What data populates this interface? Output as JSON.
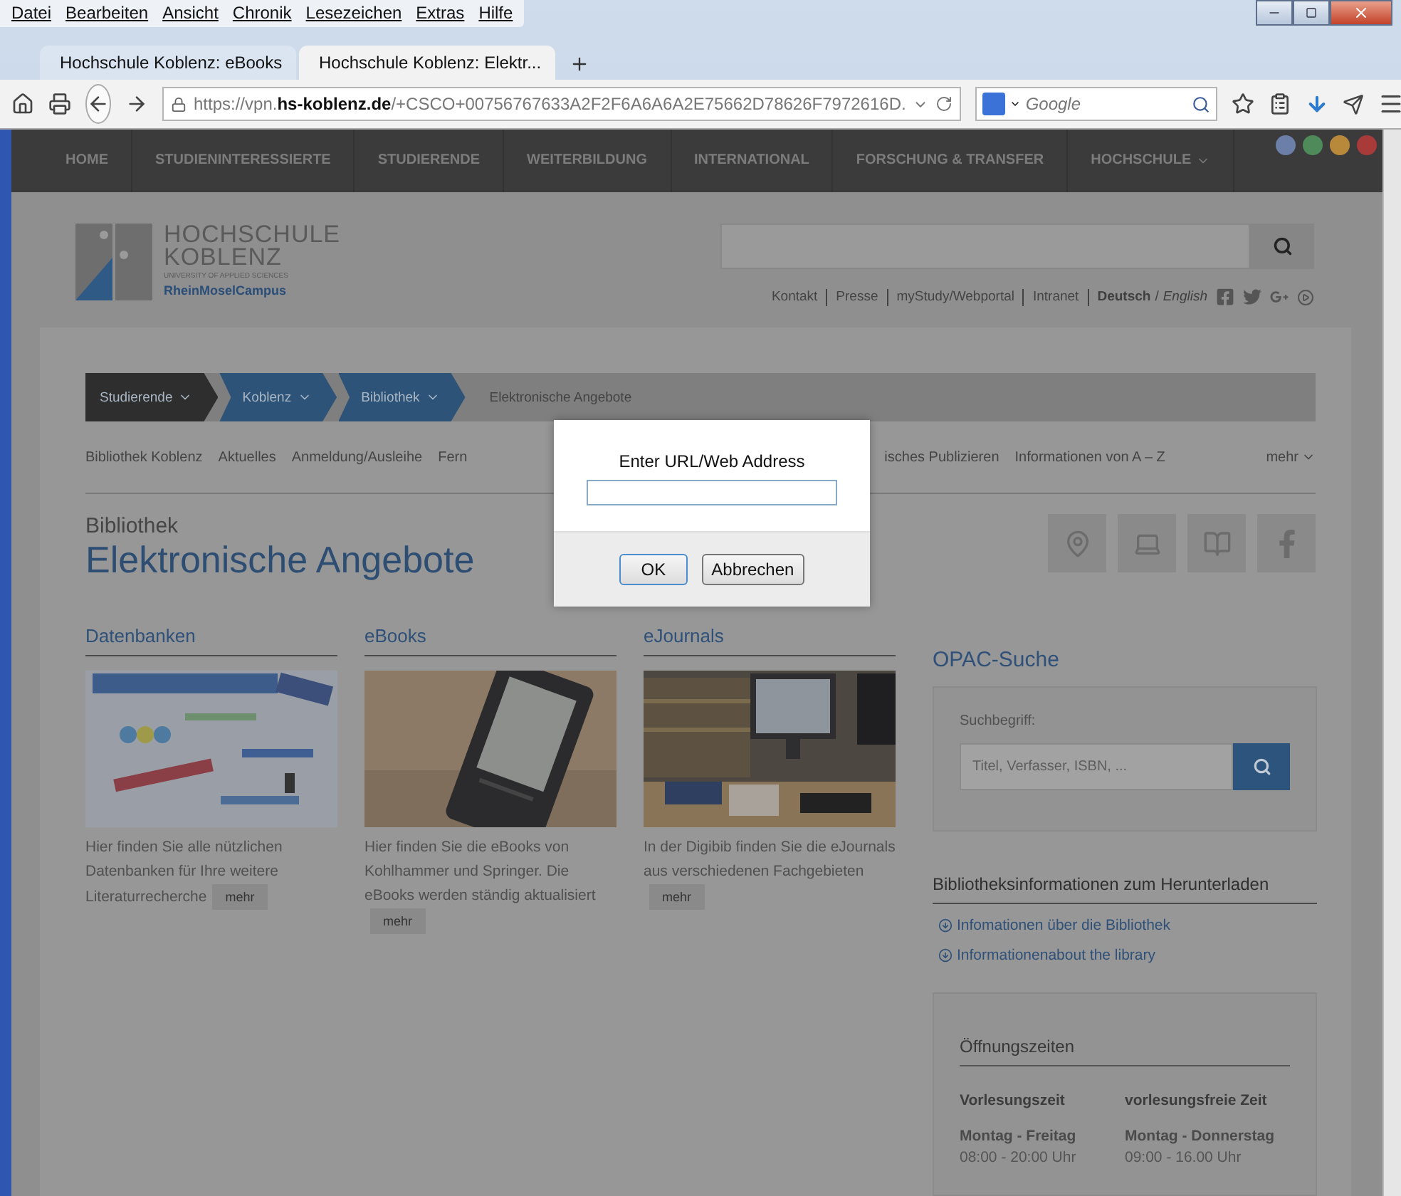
{
  "browser": {
    "menu": [
      "Datei",
      "Bearbeiten",
      "Ansicht",
      "Chronik",
      "Lesezeichen",
      "Extras",
      "Hilfe"
    ],
    "tabs": [
      {
        "title": "Hochschule Koblenz: eBooks",
        "selected": false
      },
      {
        "title": "Hochschule Koblenz: Elektr...",
        "selected": true
      }
    ],
    "url": {
      "prefix": "https://vpn.",
      "host": "hs-koblenz.de",
      "path": "/+CSCO+00756767633A2F2F6A6A6A2E75662D78626F7972616D."
    },
    "search": {
      "placeholder": "Google"
    }
  },
  "site": {
    "nav": [
      "HOME",
      "STUDIENINTERESSIERTE",
      "STUDIERENDE",
      "WEITERBILDUNG",
      "INTERNATIONAL",
      "FORSCHUNG & TRANSFER",
      "HOCHSCHULE"
    ],
    "logo": {
      "line1": "HOCHSCHULE",
      "line2": "KOBLENZ",
      "tagline": "UNIVERSITY OF APPLIED SCIENCES",
      "campus": "RheinMoselCampus"
    },
    "service_links": [
      "Kontakt",
      "Presse",
      "myStudy/Webportal",
      "Intranet"
    ],
    "languages": [
      {
        "label": "Deutsch",
        "selected": true
      },
      {
        "label": "English",
        "selected": false
      }
    ],
    "language_separator": "/",
    "breadcrumb": [
      {
        "label": "Studierende",
        "kind": "section"
      },
      {
        "label": "Koblenz",
        "kind": "link"
      },
      {
        "label": "Bibliothek",
        "kind": "link"
      },
      {
        "label": "Elektronische Angebote",
        "kind": "current"
      }
    ],
    "subnav_left": [
      "Bibliothek Koblenz",
      "Aktuelles",
      "Anmeldung/Ausleihe",
      "Fern"
    ],
    "subnav_right": [
      "isches Publizieren",
      "Informationen von A – Z"
    ],
    "subnav_more": "mehr",
    "heading": {
      "overline": "Bibliothek",
      "title": "Elektronische Angebote"
    },
    "columns": [
      {
        "title": "Datenbanken",
        "text": "Hier finden Sie alle nützlichen Datenbanken für Ihre weitere Literaturrecherche",
        "more": "mehr"
      },
      {
        "title": "eBooks",
        "text": "Hier finden Sie die eBooks von Kohlhammer und Springer. Die eBooks werden ständig aktualisiert",
        "more": "mehr"
      },
      {
        "title": "eJournals",
        "text": "In der Digibib finden Sie die eJournals aus verschiedenen Fachgebieten",
        "more": "mehr"
      }
    ],
    "sidebar": {
      "opac_title": "OPAC-Suche",
      "search_label": "Suchbegriff:",
      "search_placeholder": "Titel, Verfasser, ISBN, ...",
      "downloads_title": "Bibliotheksinformationen zum Herunterladen",
      "downloads": [
        "Infomationen über die Bibliothek",
        "Informationenabout the library"
      ],
      "hours_title": "Öffnungszeiten",
      "hours": [
        {
          "title": "Vorlesungszeit",
          "days": "Montag - Freitag",
          "time": "08:00 - 20:00 Uhr"
        },
        {
          "title": "vorlesungsfreie Zeit",
          "days": "Montag - Donnerstag",
          "time": "09:00 - 16.00 Uhr"
        }
      ]
    }
  },
  "dialog": {
    "label": "Enter URL/Web Address",
    "ok": "OK",
    "cancel": "Abbrechen"
  }
}
